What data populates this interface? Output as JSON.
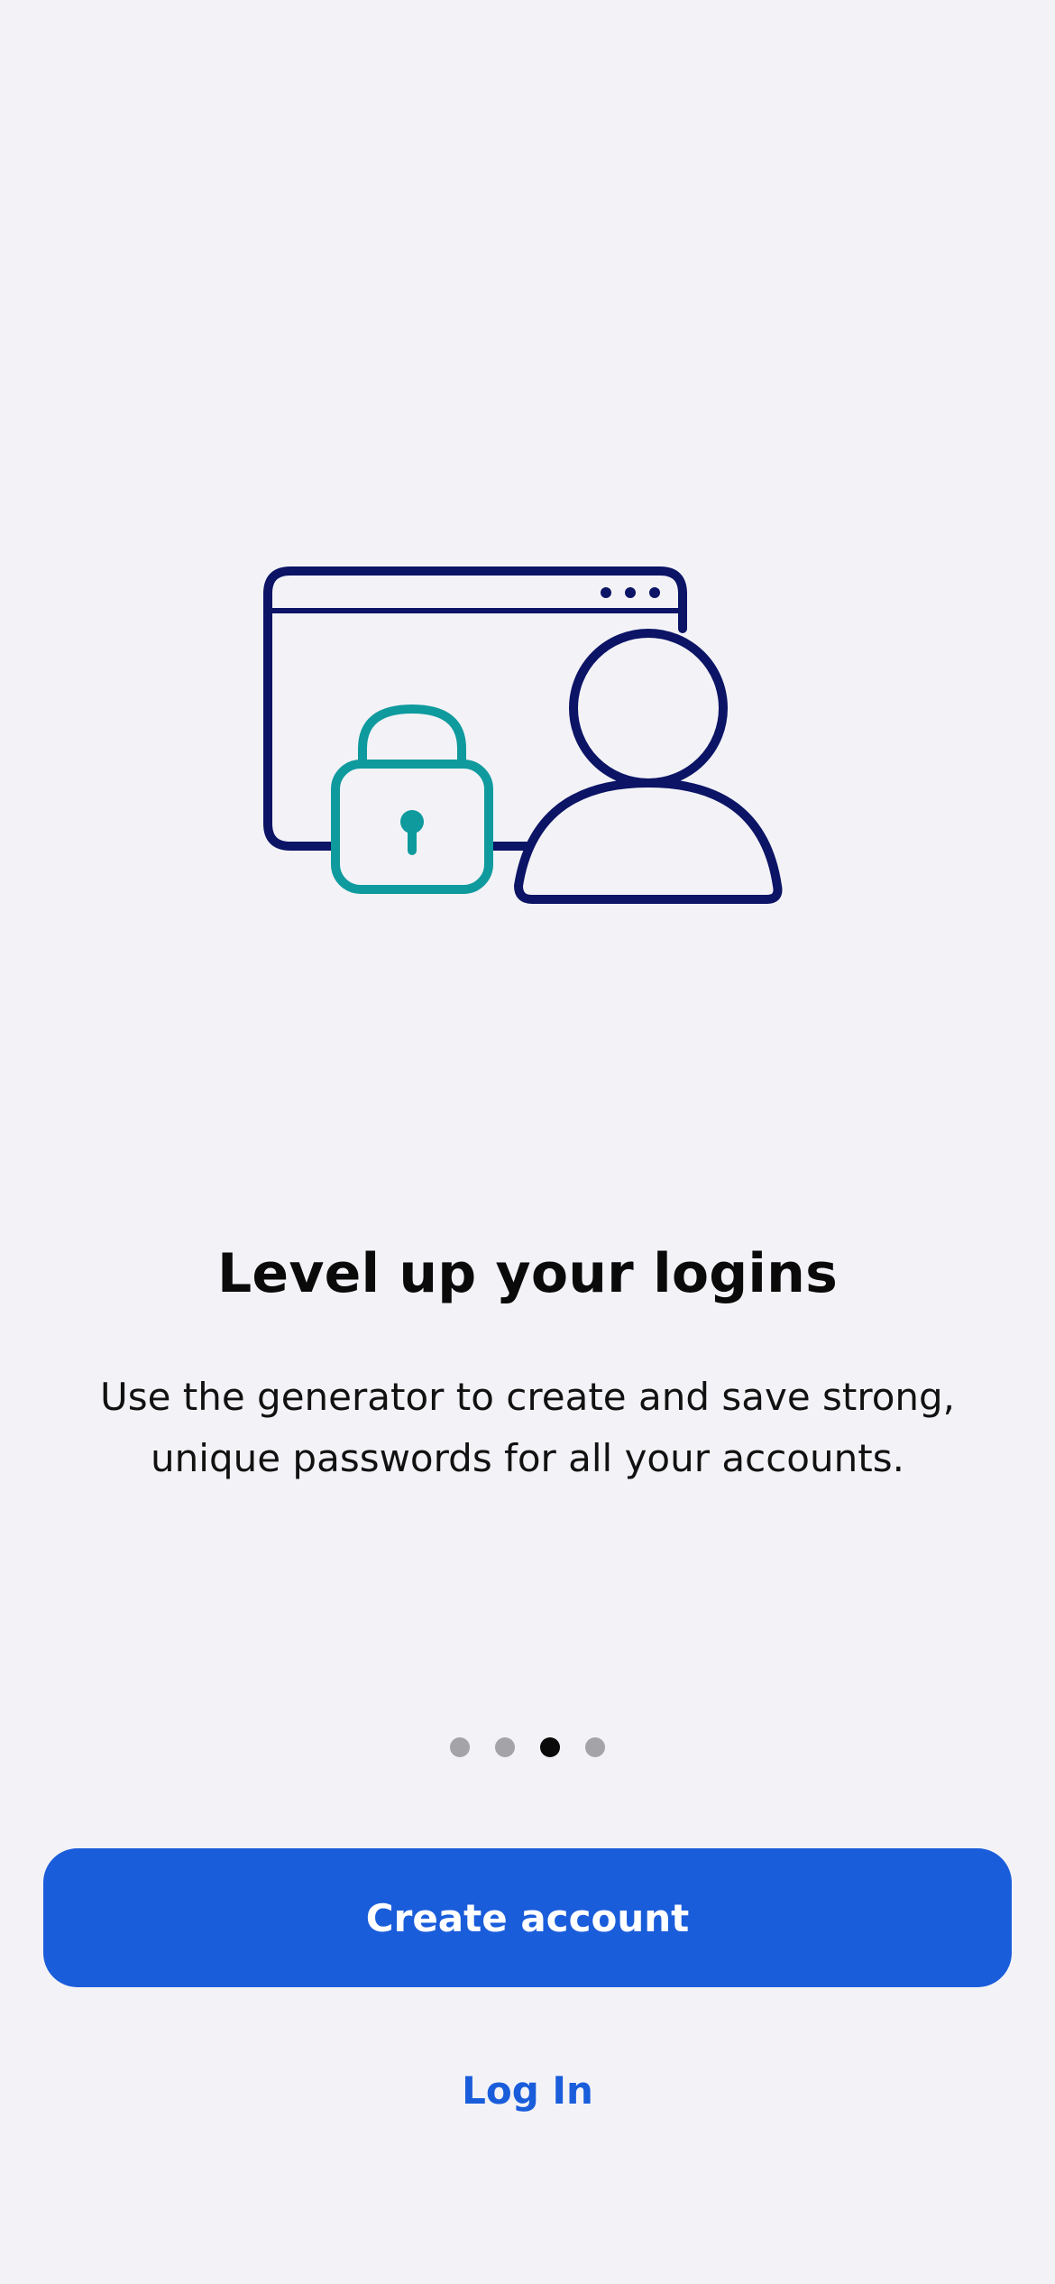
{
  "onboarding": {
    "title": "Level up your logins",
    "description": "Use the generator to create and save strong, unique passwords for all your accounts.",
    "illustration": {
      "icon": "secure-login-illustration",
      "primary_color": "#0c1466",
      "accent_color": "#0f9a9e"
    },
    "pagination": {
      "total": 4,
      "active_index": 2
    }
  },
  "actions": {
    "create_account_label": "Create account",
    "log_in_label": "Log In"
  },
  "colors": {
    "background": "#f3f3f7",
    "primary": "#1a5ddb",
    "dot_inactive": "#a3a3a8",
    "dot_active": "#0a0a0a"
  }
}
